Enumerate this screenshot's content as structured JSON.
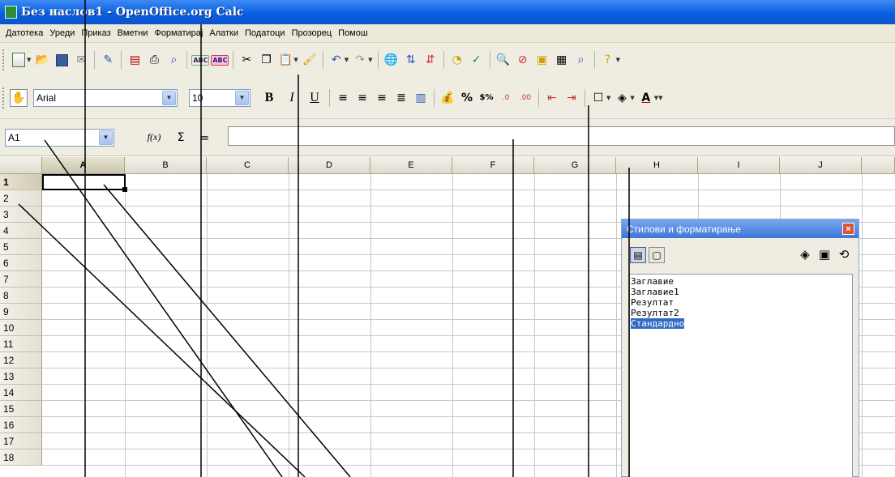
{
  "window": {
    "title": "Без наслов1 - OpenOffice.org Calc"
  },
  "menu": [
    "Датотека",
    "Уреди",
    "Приказ",
    "Вметни",
    "Форматирај",
    "Алатки",
    "Податоци",
    "Прозорец",
    "Помош"
  ],
  "toolbar1": {
    "icons": [
      "new-document-icon",
      "open-icon",
      "save-icon",
      "email-icon",
      "edit-file-icon",
      "export-pdf-icon",
      "print-icon",
      "page-preview-icon",
      "spellcheck-icon",
      "autospellcheck-icon",
      "cut-icon",
      "copy-icon",
      "paste-icon",
      "format-paintbrush-icon",
      "undo-icon",
      "redo-icon",
      "hyperlink-icon",
      "sort-ascending-icon",
      "sort-descending-icon",
      "chart-icon",
      "show-draw-functions-icon",
      "find-replace-icon",
      "navigator-icon",
      "gallery-icon",
      "data-sources-icon",
      "zoom-icon",
      "help-icon"
    ]
  },
  "toolbar2": {
    "font_name": "Arial",
    "font_size": "10",
    "bold": "B",
    "italic": "I",
    "underline": "U",
    "currency_label": "$%",
    "percent_label": "%"
  },
  "formula_bar": {
    "name_box": "A1",
    "function_wizard": "f(x)",
    "sum": "Σ",
    "equals": "=",
    "content": ""
  },
  "grid": {
    "columns": [
      "A",
      "B",
      "C",
      "D",
      "E",
      "F",
      "G",
      "H",
      "I",
      "J"
    ],
    "active_column": "A",
    "rows": [
      "1",
      "2",
      "3",
      "4",
      "5",
      "6",
      "7",
      "8",
      "9",
      "10",
      "11",
      "12",
      "13",
      "14",
      "15",
      "16",
      "17",
      "18"
    ],
    "active_row": "1"
  },
  "styles_panel": {
    "title": "Стилови и форматирање",
    "close": "×",
    "items": [
      "Заглавие",
      "Заглавие1",
      "Резултат",
      "Резултат2",
      "Стандардно"
    ],
    "selected": "Стандардно"
  }
}
